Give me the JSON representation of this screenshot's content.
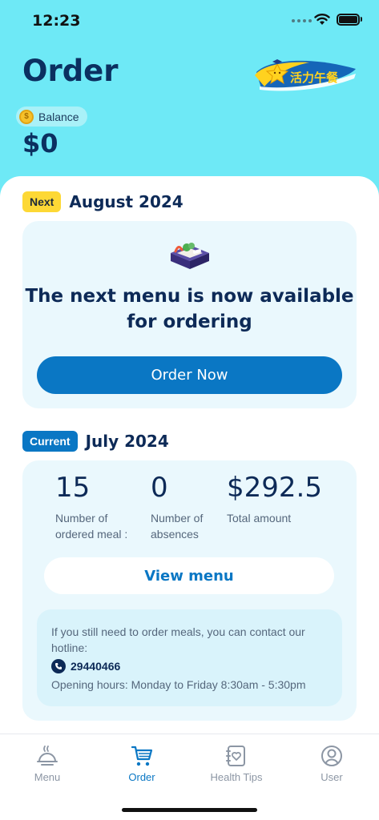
{
  "status_bar": {
    "time": "12:23"
  },
  "header": {
    "title": "Order",
    "logo_text": "活力午餐",
    "balance_label": "Balance",
    "balance_value": "$0"
  },
  "next_section": {
    "badge": "Next",
    "month": "August 2024",
    "heading_line1": "The next menu is now available",
    "heading_line2": "for ordering",
    "button_label": "Order Now"
  },
  "current_section": {
    "badge": "Current",
    "month": "July 2024",
    "stats": [
      {
        "value": "15",
        "label_line1": "Number of",
        "label_line2": "ordered meal :"
      },
      {
        "value": "0",
        "label_line1": "Number of",
        "label_line2": "absences"
      },
      {
        "value": "$292.5",
        "label_line1": "Total amount",
        "label_line2": ""
      }
    ],
    "view_menu_label": "View menu",
    "info": {
      "text": "If you still need to order meals, you can contact our hotline:",
      "hotline": "29440466",
      "hours": "Opening hours: Monday to Friday 8:30am - 5:30pm"
    }
  },
  "tab_bar": {
    "items": [
      {
        "label": "Menu",
        "icon": "dish-icon"
      },
      {
        "label": "Order",
        "icon": "cart-icon",
        "active": true
      },
      {
        "label": "Health Tips",
        "icon": "health-book-icon"
      },
      {
        "label": "User",
        "icon": "user-icon"
      }
    ]
  },
  "colors": {
    "header_bg": "#6ee9f6",
    "accent": "#0a77c4",
    "next_badge": "#fdd835",
    "text_dark": "#0d2a57"
  }
}
